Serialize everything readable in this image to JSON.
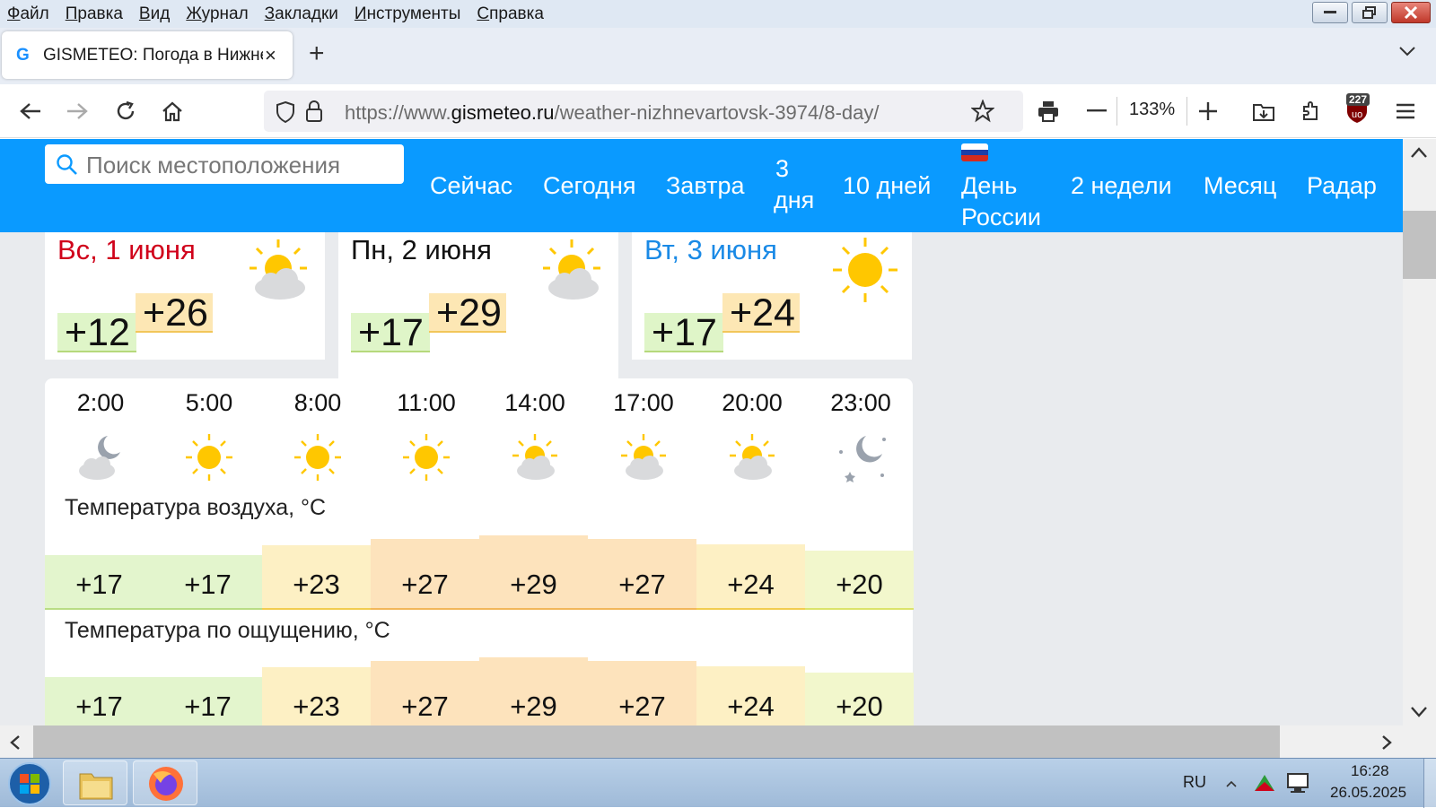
{
  "menu": [
    "Файл",
    "Правка",
    "Вид",
    "Журнал",
    "Закладки",
    "Инструменты",
    "Справка"
  ],
  "tab": {
    "favicon": "G",
    "title": "GISMETEO: Погода в Нижне",
    "close": "×"
  },
  "newtab_label": "+",
  "url": {
    "prefix": "https://www.",
    "domain": "gismeteo.ru",
    "path": "/weather-nizhnevartovsk-3974/8-day/"
  },
  "zoom": "133%",
  "ext_badge": "227",
  "site": {
    "search_placeholder": "Поиск местоположения",
    "nav": [
      "Сейчас",
      "Сегодня",
      "Завтра",
      "3",
      "дня",
      "10 дней",
      "День",
      "России",
      "2 недели",
      "Месяц",
      "Радар"
    ]
  },
  "days": [
    {
      "date": "Вс, 1 июня",
      "color": "#d0021b",
      "min": "+12",
      "max": "+26",
      "icon": "partly-cloudy-icon"
    },
    {
      "date": "Пн, 2 июня",
      "color": "#111111",
      "min": "+17",
      "max": "+29",
      "icon": "partly-cloudy-icon"
    },
    {
      "date": "Вт, 3 июня",
      "color": "#1a8ae6",
      "min": "+17",
      "max": "+24",
      "icon": "sun-icon"
    }
  ],
  "hours": [
    "2:00",
    "5:00",
    "8:00",
    "11:00",
    "14:00",
    "17:00",
    "20:00",
    "23:00"
  ],
  "hour_icons": [
    "night-cloudy-icon",
    "sun-icon",
    "sun-icon",
    "sun-icon",
    "partly-cloudy-icon",
    "partly-cloudy-icon",
    "partly-cloudy-icon",
    "night-clear-icon"
  ],
  "air_temp": {
    "label": "Температура воздуха, °C",
    "values": [
      "+17",
      "+17",
      "+23",
      "+27",
      "+29",
      "+27",
      "+24",
      "+20"
    ]
  },
  "feels_temp": {
    "label": "Температура по ощущению, °C",
    "values": [
      "+17",
      "+17",
      "+23",
      "+27",
      "+29",
      "+27",
      "+24",
      "+20"
    ]
  },
  "taskbar": {
    "lang": "RU",
    "time": "16:28",
    "date": "26.05.2025"
  }
}
